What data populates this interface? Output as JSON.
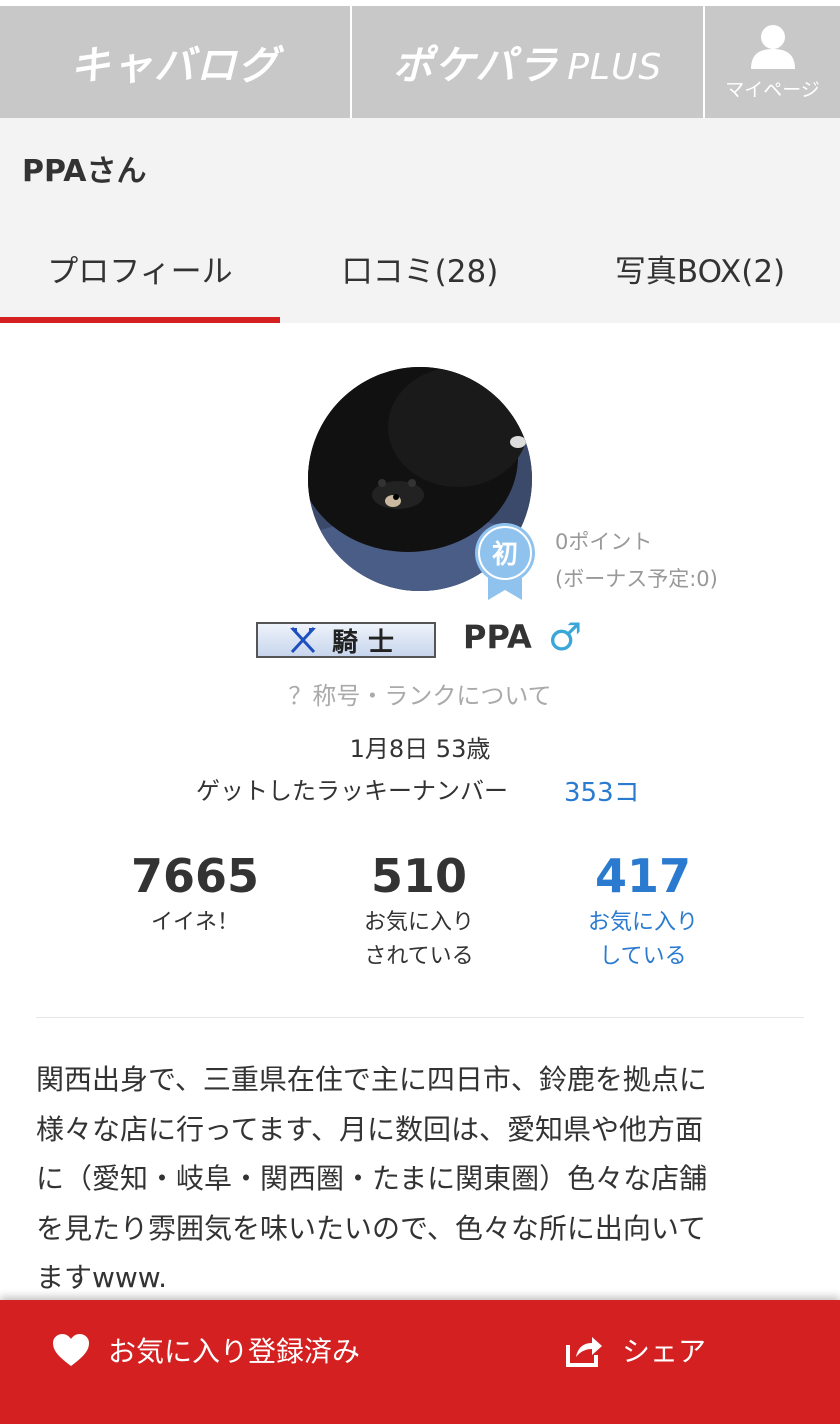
{
  "header": {
    "logo1": "キャバログ",
    "logo2_main": "ポケパラ",
    "logo2_plus": "PLUS",
    "mypage_label": "マイページ",
    "mypage_icon": "user-icon"
  },
  "page_title": "PPAさん",
  "tabs": [
    {
      "label": "プロフィール",
      "active": true
    },
    {
      "label": "口コミ(28)",
      "active": false
    },
    {
      "label": "写真BOX(2)",
      "active": false
    }
  ],
  "profile": {
    "beginner_badge": "初",
    "points": "0ポイント",
    "bonus": "(ボーナス予定:0)",
    "rank_title": "騎士",
    "username": "PPA",
    "gender_symbol": "♂",
    "rank_link": "？称号・ランクについて",
    "birthday_age": "1月8日 53歳",
    "lucky_label": "ゲットしたラッキーナンバー",
    "lucky_count": "353コ"
  },
  "stats": [
    {
      "value": "7665",
      "label1": "イイネ！",
      "label2": ""
    },
    {
      "value": "510",
      "label1": "お気に入り",
      "label2": "されている"
    },
    {
      "value": "417",
      "label1": "お気に入り",
      "label2": "している"
    }
  ],
  "bio_lines": [
    "関西出身で、三重県在住で主に四日市、鈴鹿を拠点に",
    "様々な店に行ってます、月に数回は、愛知県や他方面",
    "に（愛知・岐阜・関西圏・たまに関東圏）色々な店舗",
    "を見たり雰囲気を味いたいので、色々な所に出向いて",
    "ますwww."
  ],
  "bottom": {
    "favorite_label": "お気に入り登録済み",
    "share_label": "シェア"
  },
  "colors": {
    "accent_red": "#d42020",
    "link_blue": "#2a7bd0",
    "header_gray": "#c8c8c8"
  }
}
